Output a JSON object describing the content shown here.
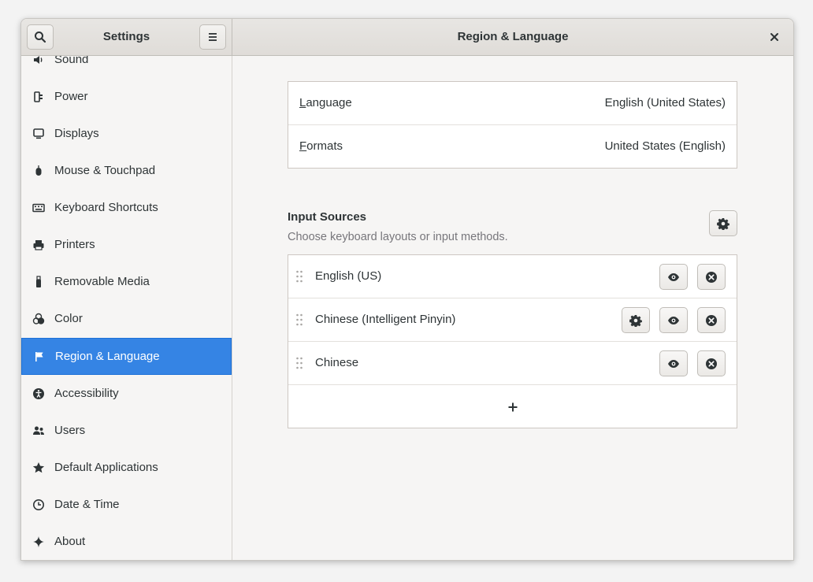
{
  "window": {
    "sidebar_title": "Settings",
    "main_title": "Region & Language"
  },
  "sidebar": {
    "items": [
      {
        "label": "Sound",
        "icon": "speaker-icon"
      },
      {
        "label": "Power",
        "icon": "power-plug-icon"
      },
      {
        "label": "Displays",
        "icon": "display-icon"
      },
      {
        "label": "Mouse & Touchpad",
        "icon": "mouse-icon"
      },
      {
        "label": "Keyboard Shortcuts",
        "icon": "keyboard-icon"
      },
      {
        "label": "Printers",
        "icon": "printer-icon"
      },
      {
        "label": "Removable Media",
        "icon": "usb-icon"
      },
      {
        "label": "Color",
        "icon": "color-circles-icon"
      },
      {
        "label": "Region & Language",
        "icon": "flag-icon",
        "active": true
      },
      {
        "label": "Accessibility",
        "icon": "accessibility-icon"
      },
      {
        "label": "Users",
        "icon": "users-icon"
      },
      {
        "label": "Default Applications",
        "icon": "star-icon"
      },
      {
        "label": "Date & Time",
        "icon": "clock-icon"
      },
      {
        "label": "About",
        "icon": "sparkle-icon"
      }
    ]
  },
  "region": {
    "language_label": "anguage",
    "language_mnemonic": "L",
    "language_value": "English (United States)",
    "formats_label": "ormats",
    "formats_mnemonic": "F",
    "formats_value": "United States (English)"
  },
  "input_sources": {
    "title": "Input Sources",
    "subtitle": "Choose keyboard layouts or input methods.",
    "items": [
      {
        "name": "English (US)",
        "has_settings": false
      },
      {
        "name": "Chinese (Intelligent Pinyin)",
        "has_settings": true
      },
      {
        "name": "Chinese",
        "has_settings": false
      }
    ]
  },
  "colors": {
    "accent": "#3584e4",
    "background": "#f6f5f4"
  }
}
